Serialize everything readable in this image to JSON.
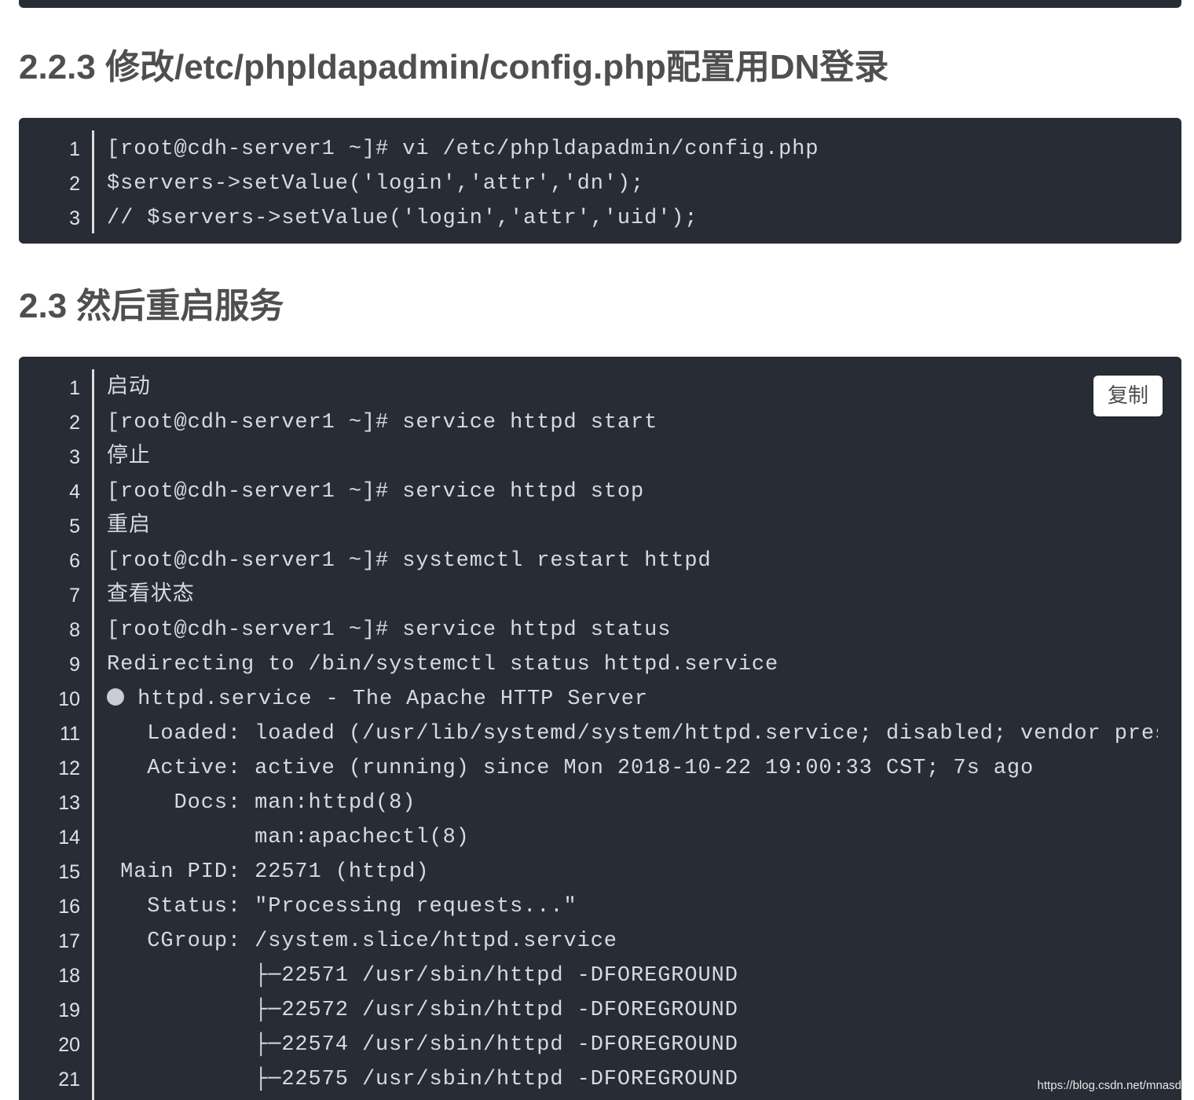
{
  "section_config": {
    "heading": "2.2.3 修改/etc/phpldapadmin/config.php配置用DN登录",
    "lines": [
      {
        "num": "1",
        "text": "[root@cdh-server1 ~]# vi /etc/phpldapadmin/config.php"
      },
      {
        "num": "2",
        "text": "$servers->setValue('login','attr','dn');"
      },
      {
        "num": "3",
        "text": "// $servers->setValue('login','attr','uid');"
      }
    ]
  },
  "section_restart": {
    "heading": "2.3 然后重启服务",
    "copy_label": "复制",
    "lines": [
      {
        "num": "1",
        "text": "启动"
      },
      {
        "num": "2",
        "text": "[root@cdh-server1 ~]# service httpd start"
      },
      {
        "num": "3",
        "text": "停止"
      },
      {
        "num": "4",
        "text": "[root@cdh-server1 ~]# service httpd stop"
      },
      {
        "num": "5",
        "text": "重启"
      },
      {
        "num": "6",
        "text": "[root@cdh-server1 ~]# systemctl restart httpd"
      },
      {
        "num": "7",
        "text": "查看状态"
      },
      {
        "num": "8",
        "text": "[root@cdh-server1 ~]# service httpd status"
      },
      {
        "num": "9",
        "text": "Redirecting to /bin/systemctl status httpd.service"
      },
      {
        "num": "10",
        "text": " httpd.service - The Apache HTTP Server",
        "dot": true
      },
      {
        "num": "11",
        "text": "   Loaded: loaded (/usr/lib/systemd/system/httpd.service; disabled; vendor prese"
      },
      {
        "num": "12",
        "text": "   Active: active (running) since Mon 2018-10-22 19:00:33 CST; 7s ago"
      },
      {
        "num": "13",
        "text": "     Docs: man:httpd(8)"
      },
      {
        "num": "14",
        "text": "           man:apachectl(8)"
      },
      {
        "num": "15",
        "text": " Main PID: 22571 (httpd)"
      },
      {
        "num": "16",
        "text": "   Status: \"Processing requests...\""
      },
      {
        "num": "17",
        "text": "   CGroup: /system.slice/httpd.service"
      },
      {
        "num": "18",
        "text": "           ├─22571 /usr/sbin/httpd -DFOREGROUND"
      },
      {
        "num": "19",
        "text": "           ├─22572 /usr/sbin/httpd -DFOREGROUND"
      },
      {
        "num": "20",
        "text": "           ├─22574 /usr/sbin/httpd -DFOREGROUND"
      },
      {
        "num": "21",
        "text": "           ├─22575 /usr/sbin/httpd -DFOREGROUND"
      }
    ]
  },
  "watermark": "https://blog.csdn.net/mnasd",
  "colors": {
    "code_background": "#282c34",
    "code_text": "#d7dae0",
    "heading_text": "#4f4f4f"
  }
}
